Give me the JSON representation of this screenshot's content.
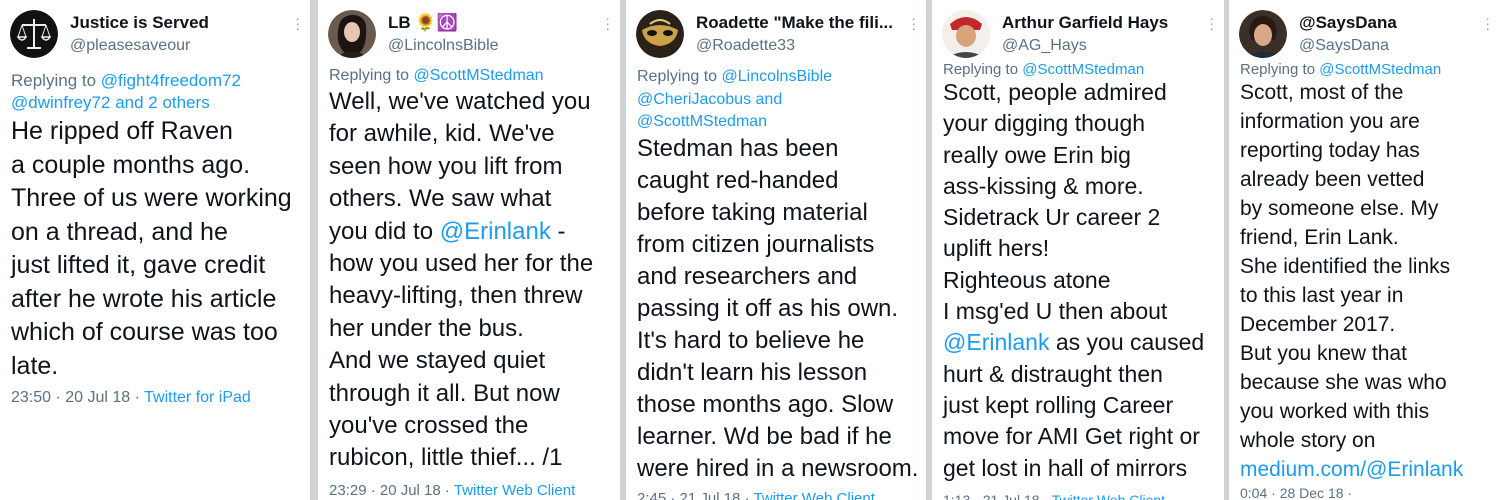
{
  "tweets": [
    {
      "display_name": "Justice is Served",
      "handle": "@pleasesaveour",
      "replying_prefix": "Replying to ",
      "replying_mentions": "@fight4freedom72\n@dwinfrey72 and 2 others",
      "text": "He ripped off Raven\na couple months ago.\nThree of us were working\non a thread, and he\njust lifted it, gave credit\nafter he wrote his article\nwhich of course was too\nlate.",
      "timestamp": "23:50 · 20 Jul 18 · ",
      "source": "Twitter for iPad"
    },
    {
      "display_name": "LB 🌻☮️",
      "handle": "@LincolnsBible",
      "replying_prefix": "Replying to ",
      "replying_mentions": "@ScottMStedman",
      "text_before_link": "Well, we've watched you\nfor awhile, kid. We've\nseen how you lift from\nothers. We saw what\nyou did to ",
      "text_link": "@Erinlank",
      "text_after_link": " -\nhow you used her for the\nheavy-lifting, then threw\nher under the bus.\nAnd we stayed quiet\nthrough it all. But now\nyou've crossed the\nrubicon, little thief... /1",
      "timestamp": "23:29 · 20 Jul 18 · ",
      "source": "Twitter Web Client"
    },
    {
      "display_name": "Roadette \"Make the fili...",
      "handle": "@Roadette33",
      "replying_prefix": "Replying to ",
      "replying_mentions": "@LincolnsBible\n@CheriJacobus and\n@ScottMStedman",
      "text": "Stedman has been\ncaught red-handed\nbefore taking material\nfrom citizen journalists\nand researchers and\npassing it off as his own.\nIt's hard to believe he\ndidn't learn his lesson\nthose months ago. Slow\nlearner. Wd be bad if he\nwere hired in a newsroom.",
      "timestamp": "2:45 · 21 Jul 18 · ",
      "source": "Twitter Web Client"
    },
    {
      "display_name": "Arthur Garfield Hays",
      "handle": "@AG_Hays",
      "replying_prefix": "Replying to ",
      "replying_mentions": "@ScottMStedman",
      "text_before_link": "Scott, people admired\nyour digging though\nreally owe Erin big\nass-kissing & more.\nSidetrack Ur career 2\nuplift hers!\nRighteous atone\nI msg'ed U then about\n",
      "text_link": "@Erinlank",
      "text_after_link": " as you caused\nhurt & distraught then\njust kept rolling Career\nmove for AMI Get right or\nget lost in hall of mirrors",
      "timestamp": "1:13 · 21 Jul 18 · ",
      "source": "Twitter Web Client"
    },
    {
      "display_name": "@SaysDana",
      "handle": "@SaysDana",
      "replying_prefix": "Replying to ",
      "replying_mentions": "@ScottMStedman",
      "text_before_link": "Scott, most of the\ninformation you are\nreporting today has\nalready been vetted\nby someone else.  My\nfriend, Erin Lank.\nShe identified the links\nto this last year in\nDecember 2017.\nBut you knew that\nbecause she was who\nyou worked with this\nwhole story on\n",
      "text_link": "medium.com/@Erinlank",
      "text_after_link": "",
      "timestamp": "0:04 · 28 Dec 18 · ",
      "source": ""
    }
  ],
  "icons": {
    "more": "more-options-icon"
  },
  "colors": {
    "link": "#1d9bf0",
    "muted": "#5b7083",
    "text": "#0f1419"
  }
}
